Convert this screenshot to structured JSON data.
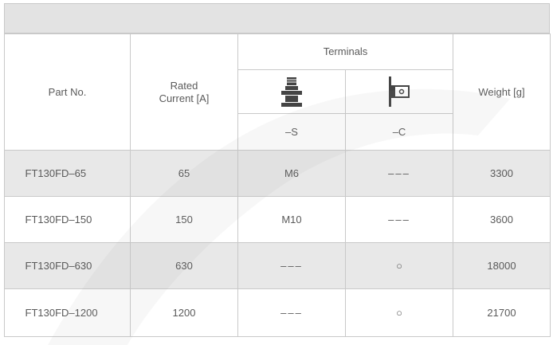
{
  "table": {
    "headers": {
      "part_no": "Part No.",
      "rated_current_line1": "Rated",
      "rated_current_line2": "Current [A]",
      "terminals": "Terminals",
      "terminal_s_icon": "stud-terminal-icon",
      "terminal_c_icon": "flag-terminal-icon",
      "terminal_s": "–S",
      "terminal_c": "–C",
      "weight": "Weight [g]"
    },
    "rows": [
      {
        "part_no": "FT130FD–65",
        "rated_current": "65",
        "terminal_s": "M6",
        "terminal_c": "–––",
        "weight": "3300"
      },
      {
        "part_no": "FT130FD–150",
        "rated_current": "150",
        "terminal_s": "M10",
        "terminal_c": "–––",
        "weight": "3600"
      },
      {
        "part_no": "FT130FD–630",
        "rated_current": "630",
        "terminal_s": "–––",
        "terminal_c": "○",
        "weight": "18000"
      },
      {
        "part_no": "FT130FD–1200",
        "rated_current": "1200",
        "terminal_s": "–––",
        "terminal_c": "○",
        "weight": "21700"
      }
    ]
  },
  "colors": {
    "border": "#c9c9c9",
    "band": "#e3e3e3",
    "shaded_row": "#e8e8e8",
    "text": "#5a5a5a"
  }
}
